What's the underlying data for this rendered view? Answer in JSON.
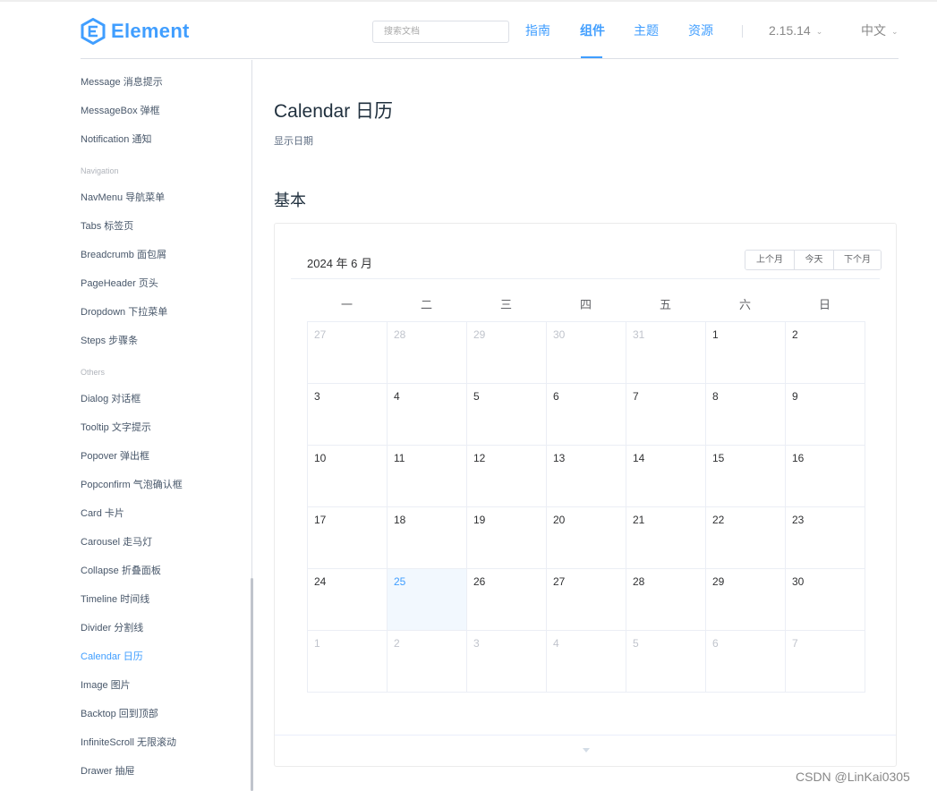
{
  "header": {
    "logo_text": "Element",
    "search_placeholder": "搜索文档",
    "nav": {
      "guide": "指南",
      "components": "组件",
      "theme": "主题",
      "resource": "资源"
    },
    "version": "2.15.14",
    "language": "中文",
    "brand_color": "#409eff"
  },
  "sidebar": {
    "items": [
      {
        "label": "Message 消息提示"
      },
      {
        "label": "MessageBox 弹框"
      },
      {
        "label": "Notification 通知"
      },
      {
        "label": "Navigation",
        "group": true
      },
      {
        "label": "NavMenu 导航菜单"
      },
      {
        "label": "Tabs 标签页"
      },
      {
        "label": "Breadcrumb 面包屑"
      },
      {
        "label": "PageHeader 页头"
      },
      {
        "label": "Dropdown 下拉菜单"
      },
      {
        "label": "Steps 步骤条"
      },
      {
        "label": "Others",
        "group": true
      },
      {
        "label": "Dialog 对话框"
      },
      {
        "label": "Tooltip 文字提示"
      },
      {
        "label": "Popover 弹出框"
      },
      {
        "label": "Popconfirm 气泡确认框"
      },
      {
        "label": "Card 卡片"
      },
      {
        "label": "Carousel 走马灯"
      },
      {
        "label": "Collapse 折叠面板"
      },
      {
        "label": "Timeline 时间线"
      },
      {
        "label": "Divider 分割线"
      },
      {
        "label": "Calendar 日历",
        "active": true
      },
      {
        "label": "Image 图片"
      },
      {
        "label": "Backtop 回到顶部"
      },
      {
        "label": "InfiniteScroll 无限滚动"
      },
      {
        "label": "Drawer 抽屉"
      }
    ]
  },
  "main": {
    "title": "Calendar 日历",
    "description": "显示日期",
    "section_title": "基本"
  },
  "calendar": {
    "title": "2024 年 6 月",
    "buttons": {
      "prev": "上个月",
      "today": "今天",
      "next": "下个月"
    },
    "weekdays": [
      "一",
      "二",
      "三",
      "四",
      "五",
      "六",
      "日"
    ],
    "weeks": [
      [
        {
          "d": "27",
          "t": "prev"
        },
        {
          "d": "28",
          "t": "prev"
        },
        {
          "d": "29",
          "t": "prev"
        },
        {
          "d": "30",
          "t": "prev"
        },
        {
          "d": "31",
          "t": "prev"
        },
        {
          "d": "1",
          "t": "current"
        },
        {
          "d": "2",
          "t": "current"
        }
      ],
      [
        {
          "d": "3",
          "t": "current"
        },
        {
          "d": "4",
          "t": "current"
        },
        {
          "d": "5",
          "t": "current"
        },
        {
          "d": "6",
          "t": "current"
        },
        {
          "d": "7",
          "t": "current"
        },
        {
          "d": "8",
          "t": "current"
        },
        {
          "d": "9",
          "t": "current"
        }
      ],
      [
        {
          "d": "10",
          "t": "current"
        },
        {
          "d": "11",
          "t": "current"
        },
        {
          "d": "12",
          "t": "current"
        },
        {
          "d": "13",
          "t": "current"
        },
        {
          "d": "14",
          "t": "current"
        },
        {
          "d": "15",
          "t": "current"
        },
        {
          "d": "16",
          "t": "current"
        }
      ],
      [
        {
          "d": "17",
          "t": "current"
        },
        {
          "d": "18",
          "t": "current"
        },
        {
          "d": "19",
          "t": "current"
        },
        {
          "d": "20",
          "t": "current"
        },
        {
          "d": "21",
          "t": "current"
        },
        {
          "d": "22",
          "t": "current"
        },
        {
          "d": "23",
          "t": "current"
        }
      ],
      [
        {
          "d": "24",
          "t": "current"
        },
        {
          "d": "25",
          "t": "today"
        },
        {
          "d": "26",
          "t": "current"
        },
        {
          "d": "27",
          "t": "current"
        },
        {
          "d": "28",
          "t": "current"
        },
        {
          "d": "29",
          "t": "current"
        },
        {
          "d": "30",
          "t": "current"
        }
      ],
      [
        {
          "d": "1",
          "t": "next"
        },
        {
          "d": "2",
          "t": "next"
        },
        {
          "d": "3",
          "t": "next"
        },
        {
          "d": "4",
          "t": "next"
        },
        {
          "d": "5",
          "t": "next"
        },
        {
          "d": "6",
          "t": "next"
        },
        {
          "d": "7",
          "t": "next"
        }
      ]
    ]
  },
  "watermark": "CSDN @LinKai0305"
}
